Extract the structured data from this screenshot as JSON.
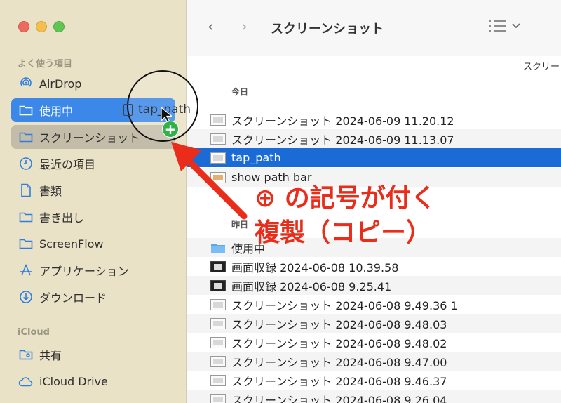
{
  "window": {
    "title": "スクリーンショット",
    "nav": {
      "back": "‹",
      "forward": "›"
    },
    "column_header": "スクリー"
  },
  "sidebar": {
    "favorites_label": "よく使う項目",
    "items": [
      {
        "label": "AirDrop",
        "icon": "airdrop-icon"
      },
      {
        "label": "使用中",
        "icon": "folder-icon",
        "state": "selected"
      },
      {
        "label": "スクリーンショット",
        "icon": "folder-icon",
        "state": "drop-target"
      },
      {
        "label": "最近の項目",
        "icon": "clock-icon"
      },
      {
        "label": "書類",
        "icon": "document-icon"
      },
      {
        "label": "書き出し",
        "icon": "folder-icon"
      },
      {
        "label": "ScreenFlow",
        "icon": "folder-icon"
      },
      {
        "label": "アプリケーション",
        "icon": "applications-icon"
      },
      {
        "label": "ダウンロード",
        "icon": "download-icon"
      }
    ],
    "icloud_label": "iCloud",
    "icloud_items": [
      {
        "label": "共有",
        "icon": "shared-folder-icon"
      },
      {
        "label": "iCloud Drive",
        "icon": "cloud-icon"
      }
    ]
  },
  "drag": {
    "ghost_label": "tap_path",
    "badge": "+"
  },
  "files": {
    "today_label": "今日",
    "today": [
      {
        "name": "スクリーンショット 2024-06-09 11.20.12",
        "kind": "screenshot"
      },
      {
        "name": "スクリーンショット 2024-06-09 11.13.07",
        "kind": "screenshot"
      },
      {
        "name": "tap_path",
        "kind": "screenshot",
        "selected": true
      },
      {
        "name": "show path bar",
        "kind": "image"
      }
    ],
    "yesterday_label": "昨日",
    "yesterday": [
      {
        "name": "使用中",
        "kind": "folder"
      },
      {
        "name": "画面収録 2024-06-08 10.39.58",
        "kind": "video"
      },
      {
        "name": "画面収録 2024-06-08 9.25.41",
        "kind": "video"
      },
      {
        "name": "スクリーンショット 2024-06-08 9.49.36 1",
        "kind": "screenshot"
      },
      {
        "name": "スクリーンショット 2024-06-08 9.48.03",
        "kind": "screenshot"
      },
      {
        "name": "スクリーンショット 2024-06-08 9.48.02",
        "kind": "screenshot"
      },
      {
        "name": "スクリーンショット 2024-06-08 9.47.00",
        "kind": "screenshot"
      },
      {
        "name": "スクリーンショット 2024-06-08 9.46.37",
        "kind": "screenshot"
      },
      {
        "name": "スクリーンショット 2024-06-08 9.26.04",
        "kind": "screenshot"
      }
    ]
  },
  "annotation": {
    "line1": "⊕ の記号が付く",
    "line2": "複製（コピー）",
    "color": "#ea2d1b"
  }
}
